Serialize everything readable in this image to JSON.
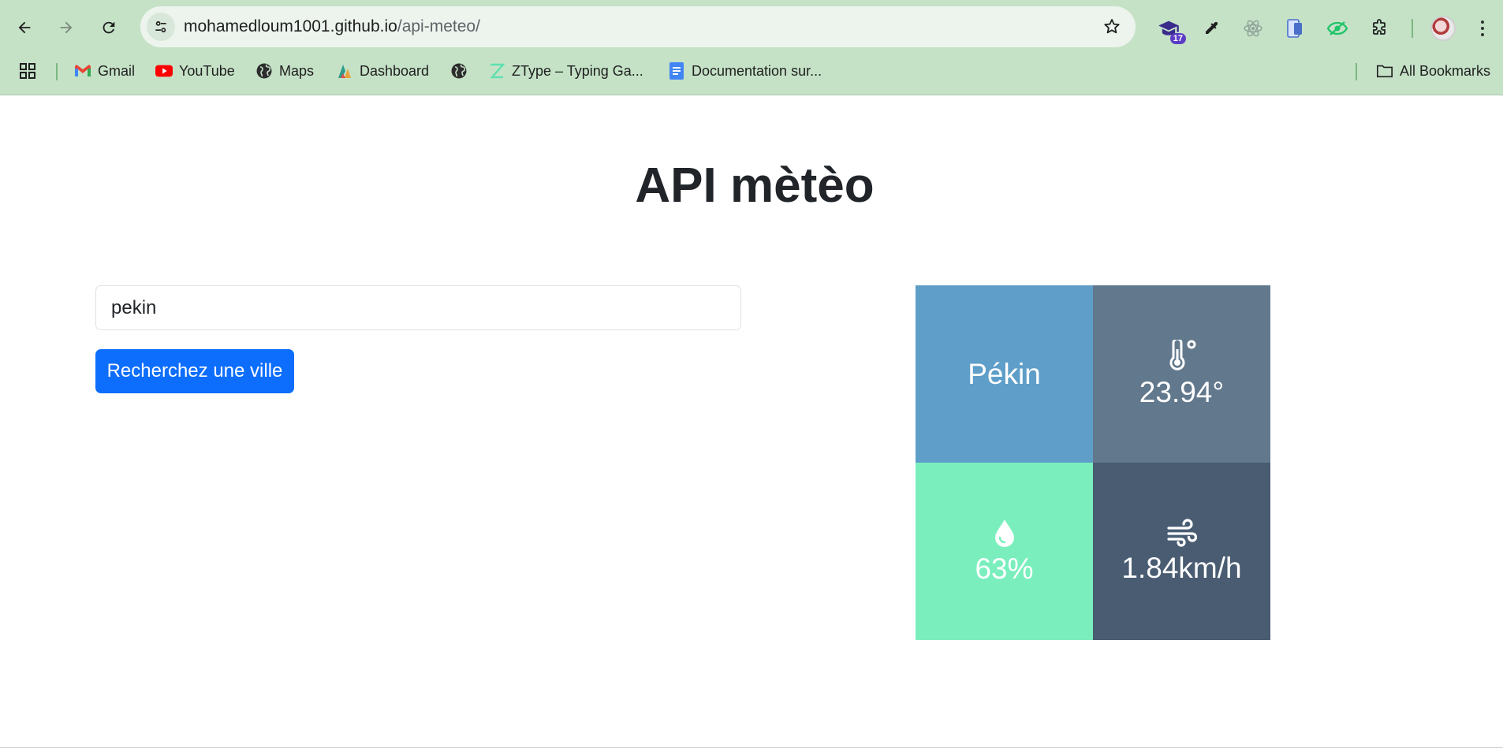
{
  "browser": {
    "url_host": "mohamedloum1001.github.io",
    "url_path": "/api-meteo/",
    "extension_badge": "17",
    "bookmarks": [
      {
        "label": "Gmail"
      },
      {
        "label": "YouTube"
      },
      {
        "label": "Maps"
      },
      {
        "label": "Dashboard"
      },
      {
        "label": ""
      },
      {
        "label": "ZType – Typing Ga..."
      },
      {
        "label": "Documentation sur..."
      }
    ],
    "all_bookmarks_label": "All Bookmarks"
  },
  "page": {
    "title": "API mètèo",
    "search": {
      "value": "pekin",
      "button_label": "Recherchez une ville"
    },
    "weather": {
      "city": "Pékin",
      "temperature": "23.94°",
      "humidity": "63%",
      "wind": "1.84km/h"
    }
  },
  "colors": {
    "chrome_bg": "#c5e2c7",
    "button_primary": "#0d6efd",
    "city_tile": "#5e9ec9",
    "temp_tile": "#62788c",
    "humidity_tile": "#7aefbd",
    "wind_tile": "#495c72"
  }
}
